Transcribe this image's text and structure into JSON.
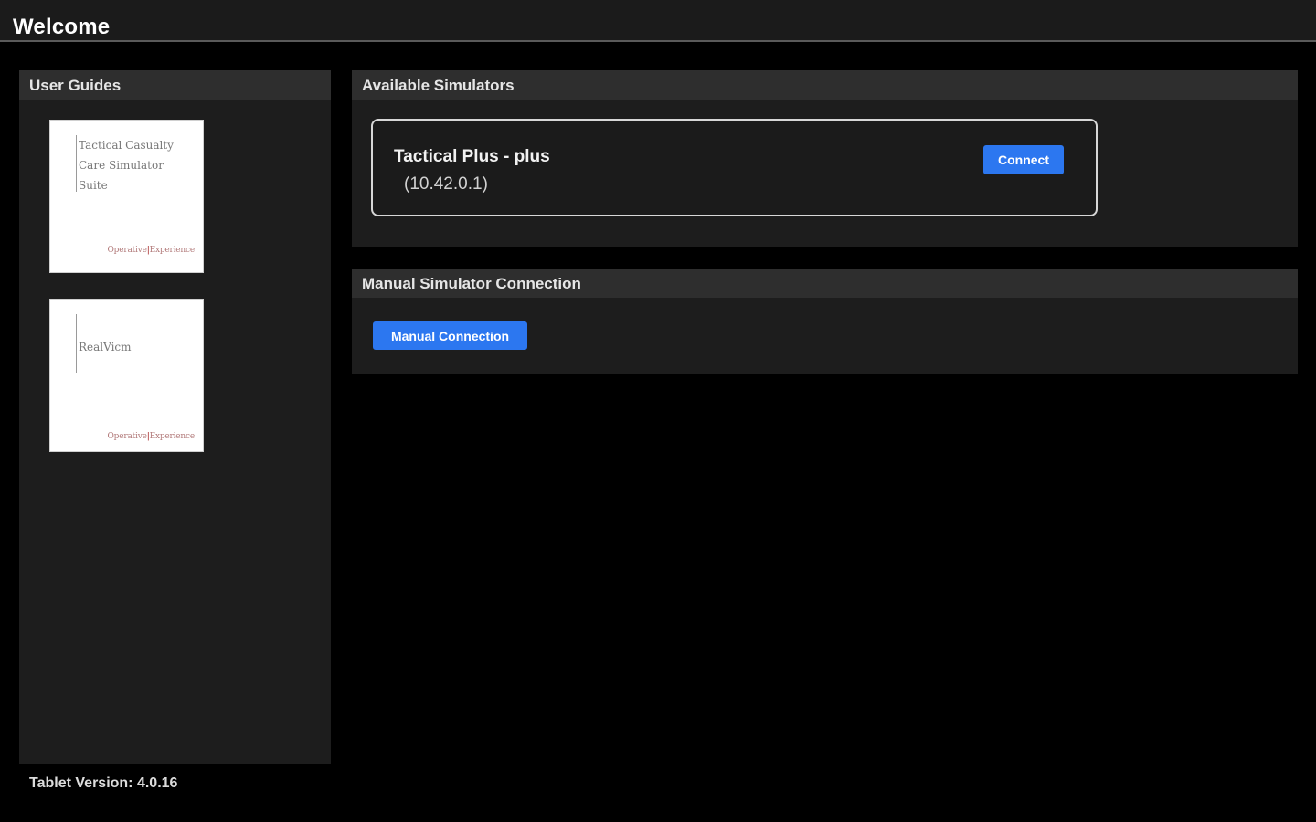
{
  "header": {
    "title": "Welcome"
  },
  "user_guides": {
    "title": "User Guides",
    "items": [
      {
        "doc_title": "Tactical Casualty Care Simulator Suite",
        "mark_left": "Operative",
        "mark_right": "Experience"
      },
      {
        "doc_title": "RealVicm",
        "mark_left": "Operative",
        "mark_right": "Experience"
      }
    ]
  },
  "available_simulators": {
    "title": "Available Simulators",
    "items": [
      {
        "name": "Tactical Plus - plus",
        "address": "(10.42.0.1)",
        "connect_label": "Connect"
      }
    ]
  },
  "manual_connection": {
    "title": "Manual Simulator Connection",
    "button_label": "Manual Connection"
  },
  "footer": {
    "version": "Tablet Version: 4.0.16"
  },
  "colors": {
    "accent": "#2c77f0",
    "background": "#000000",
    "panel": "#1d1d1d",
    "panel_header": "#2e2e2e"
  }
}
